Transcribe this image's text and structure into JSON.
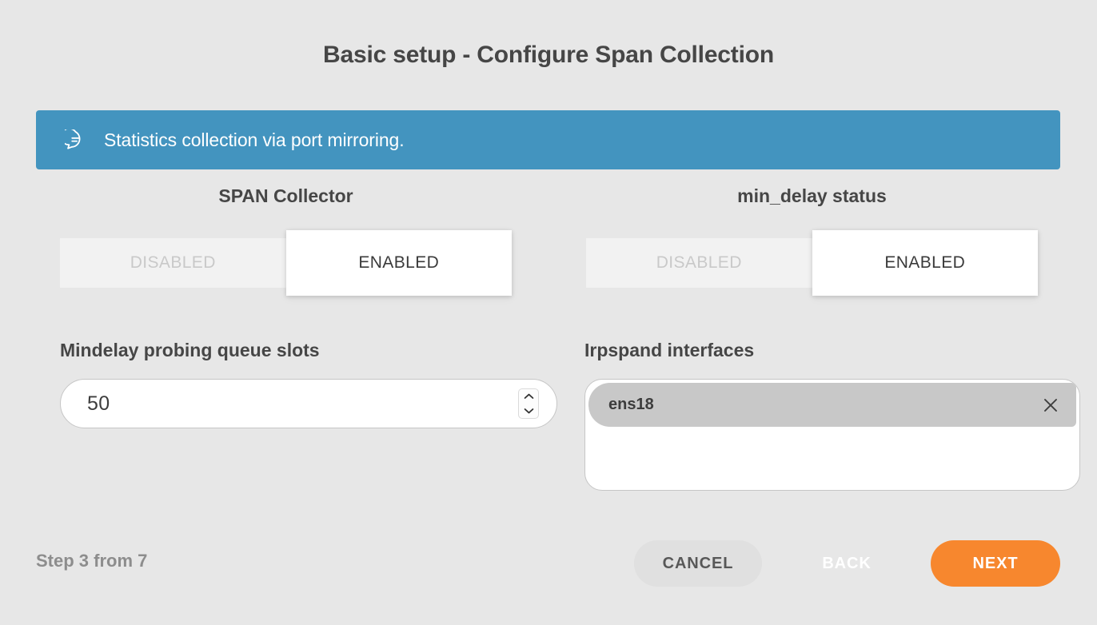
{
  "page": {
    "title": "Basic setup - Configure Span Collection",
    "background_color": "#e7e7e7"
  },
  "banner": {
    "icon": "comment-bubble-icon",
    "message": "Statistics collection via port mirroring.",
    "color": "#4394bf"
  },
  "fields": {
    "span_collector": {
      "label": "SPAN Collector",
      "options": [
        "DISABLED",
        "ENABLED"
      ],
      "selected": "ENABLED"
    },
    "min_delay_status": {
      "label": "min_delay status",
      "options": [
        "DISABLED",
        "ENABLED"
      ],
      "selected": "ENABLED"
    },
    "mindelay_queue_slots": {
      "label": "Mindelay probing queue slots",
      "value": "50",
      "placeholder": "",
      "spinner": {
        "up_icon": "chevron-up-icon",
        "down_icon": "chevron-down-icon"
      }
    },
    "irpspand_interfaces": {
      "label": "Irpspand interfaces",
      "chips": [
        {
          "label": "ens18",
          "remove_icon": "close-icon"
        }
      ],
      "placeholder": ""
    }
  },
  "footer": {
    "step_text": "Step 3 from 7",
    "cancel_label": "CANCEL",
    "back_label": "BACK",
    "next_label": "NEXT",
    "next_color": "#f7872e"
  }
}
